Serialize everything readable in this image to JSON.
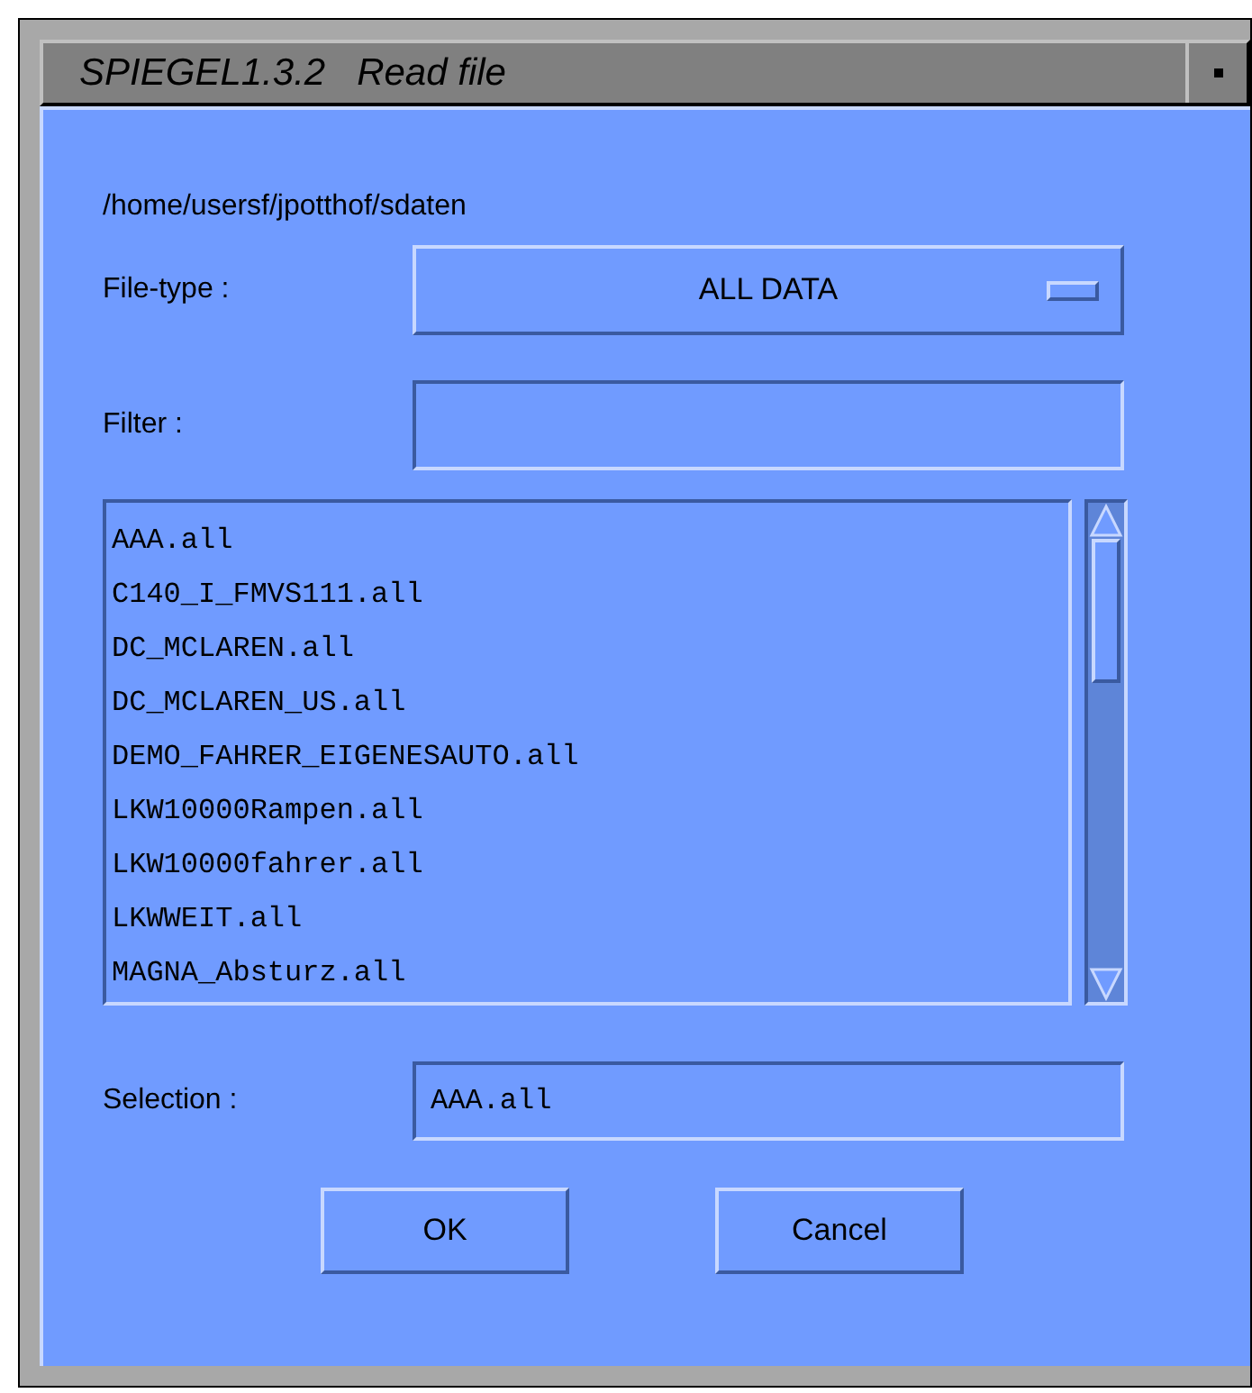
{
  "window": {
    "title": "SPIEGEL1.3.2   Read file"
  },
  "path": "/home/usersf/jpotthof/sdaten",
  "file_type": {
    "label": "File-type :",
    "value": "ALL DATA"
  },
  "filter": {
    "label": "Filter :"
  },
  "files": [
    "AAA.all",
    "C140_I_FMVS111.all",
    "DC_MCLAREN.all",
    "DC_MCLAREN_US.all",
    "DEMO_FAHRER_EIGENESAUTO.all",
    "LKW10000Rampen.all",
    "LKW10000fahrer.all",
    "LKWWEIT.all",
    "MAGNA_Absturz.all"
  ],
  "selection": {
    "label": "Selection :",
    "value": "AAA.all"
  },
  "buttons": [
    "OK",
    "Cancel"
  ]
}
